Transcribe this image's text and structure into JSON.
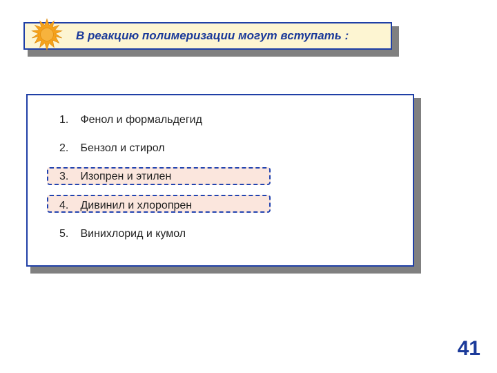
{
  "title": "В реакцию полимеризации могут вступать :",
  "options": [
    {
      "num": "1.",
      "text": "Фенол и формальдегид",
      "highlighted": false
    },
    {
      "num": "2.",
      "text": "Бензол и стирол",
      "highlighted": false
    },
    {
      "num": "3.",
      "text": "Изопрен и этилен",
      "highlighted": true
    },
    {
      "num": "4.",
      "text": "Дивинил и хлоропрен",
      "highlighted": true
    },
    {
      "num": "5.",
      "text": "Винихлорид и кумол",
      "highlighted": false
    }
  ],
  "page_number": "41",
  "colors": {
    "accent": "#1f3fa6",
    "title_bg": "#fdf5d2",
    "highlight_bg": "#fbe6dd",
    "sun": "#f5a11a"
  },
  "chart_data": {
    "type": "table",
    "title": "В реакцию полимеризации могут вступать :",
    "rows": [
      {
        "n": 1,
        "label": "Фенол и формальдегид",
        "correct": false
      },
      {
        "n": 2,
        "label": "Бензол и стирол",
        "correct": false
      },
      {
        "n": 3,
        "label": "Изопрен и этилен",
        "correct": true
      },
      {
        "n": 4,
        "label": "Дивинил и хлоропрен",
        "correct": true
      },
      {
        "n": 5,
        "label": "Винихлорид и кумол",
        "correct": false
      }
    ]
  }
}
